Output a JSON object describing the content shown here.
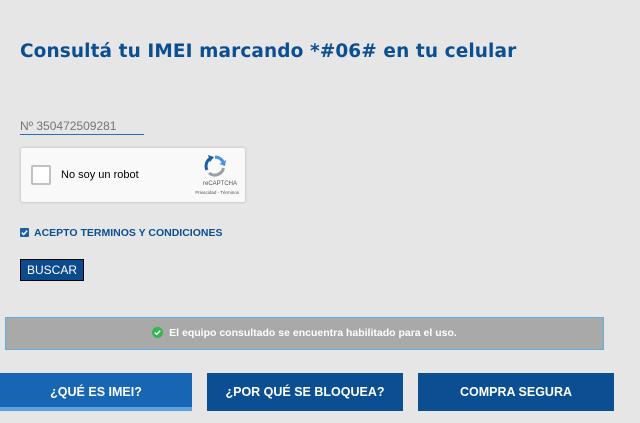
{
  "page": {
    "title": "Consultá tu IMEI marcando *#06# en tu celular"
  },
  "imei": {
    "placeholder": "Nº 350472509281"
  },
  "recaptcha": {
    "label": "No soy un robot",
    "brand": "reCAPTCHA",
    "links": "Privacidad - Términos",
    "checked": false
  },
  "terms": {
    "label": "ACEPTO TERMINOS Y CONDICIONES",
    "checked": true
  },
  "search": {
    "label": "BUSCAR"
  },
  "status": {
    "message": "El equipo consultado se encuentra habilitado para el uso.",
    "icon": "check-circle-icon",
    "color": "#2fb84a"
  },
  "nav": {
    "items": [
      {
        "label": "¿QUÉ ES IMEI?"
      },
      {
        "label": "¿POR QUÉ SE BLOQUEA?"
      },
      {
        "label": "COMPRA SEGURA"
      }
    ]
  },
  "colors": {
    "background": "#e6e6e6",
    "primary": "#0b4f92",
    "accent": "#1666b3",
    "status_bg": "#a9a9a9",
    "status_border": "#5ab0e2"
  }
}
